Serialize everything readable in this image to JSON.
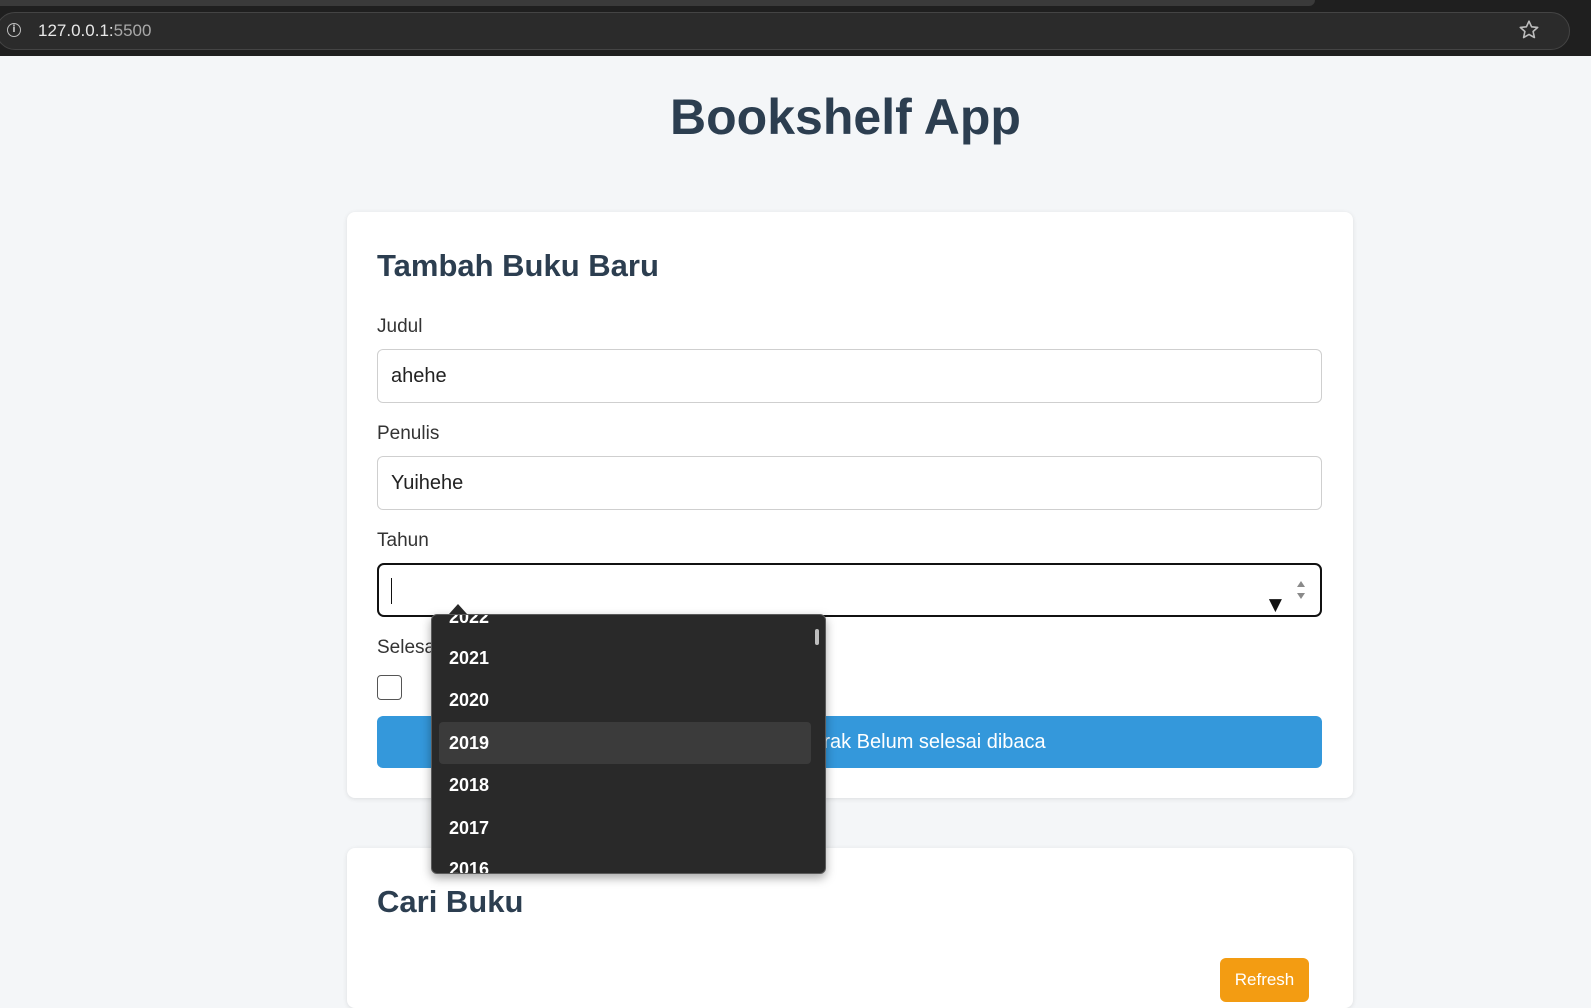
{
  "browser": {
    "url_host": "127.0.0.1:",
    "url_port": "5500"
  },
  "app_title": "Bookshelf App",
  "form": {
    "heading": "Tambah Buku Baru",
    "judul_label": "Judul",
    "judul_value": "ahehe",
    "penulis_label": "Penulis",
    "penulis_value": "Yuihehe",
    "tahun_label": "Tahun",
    "tahun_value": "",
    "selesai_label": "Selesa",
    "submit_label": "rak Belum selesai dibaca"
  },
  "year_options": {
    "partial_top": "2022",
    "items": [
      "2021",
      "2020",
      "2019",
      "2018",
      "2017"
    ],
    "highlighted": "2019",
    "partial_bottom": "2016"
  },
  "search": {
    "heading": "Cari Buku",
    "refresh_label": "Refresh"
  },
  "colors": {
    "heading": "#2c3e50",
    "primary": "#3498db",
    "refresh": "#f39c12",
    "popup_bg": "#292929"
  }
}
